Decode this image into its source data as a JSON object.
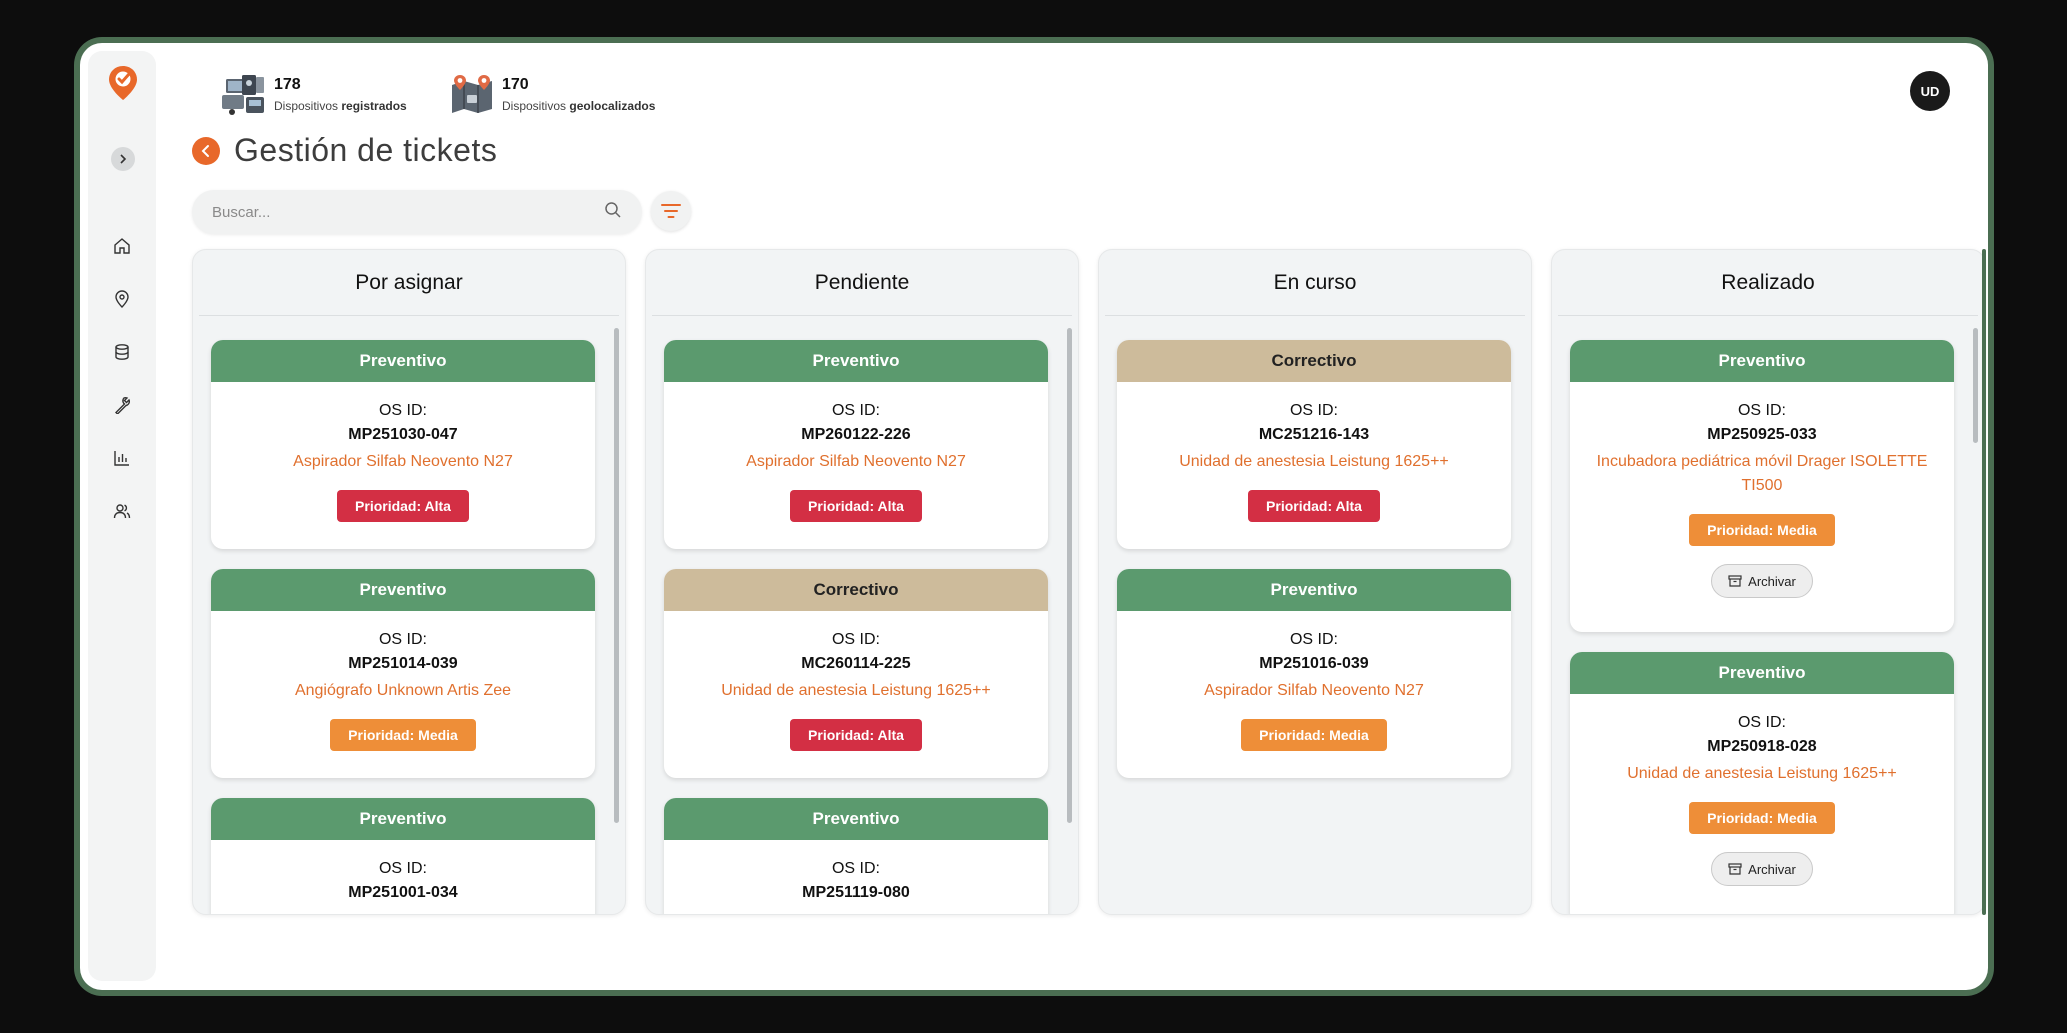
{
  "stats": [
    {
      "value": "178",
      "label_prefix": "Dispositivos",
      "label_bold": "registrados",
      "icon": "devices-registered-icon"
    },
    {
      "value": "170",
      "label_prefix": "Dispositivos",
      "label_bold": "geolocalizados",
      "icon": "devices-geolocated-icon"
    }
  ],
  "user": {
    "initials": "UD"
  },
  "page": {
    "title": "Gestión de tickets"
  },
  "search": {
    "placeholder": "Buscar..."
  },
  "sidebar": {
    "items": [
      "home-icon",
      "location-icon",
      "database-icon",
      "wrench-icon",
      "chart-icon",
      "users-icon"
    ]
  },
  "colors": {
    "accent": "#e8682a",
    "preventivo": "#5b9a6e",
    "correctivo": "#cdbb9b",
    "alta": "#d32f44",
    "media": "#ee8e38",
    "frame": "#4b6e52"
  },
  "columns": [
    {
      "title": "Por asignar",
      "cards": [
        {
          "type": "Preventivo",
          "os_label": "OS ID:",
          "os_id": "MP251030-047",
          "device": "Aspirador Silfab Neovento N27",
          "priority": "Prioridad: Alta"
        },
        {
          "type": "Preventivo",
          "os_label": "OS ID:",
          "os_id": "MP251014-039",
          "device": "Angiógrafo Unknown Artis Zee",
          "priority": "Prioridad: Media"
        },
        {
          "type": "Preventivo",
          "os_label": "OS ID:",
          "os_id": "MP251001-034",
          "device": "",
          "priority": ""
        }
      ]
    },
    {
      "title": "Pendiente",
      "cards": [
        {
          "type": "Preventivo",
          "os_label": "OS ID:",
          "os_id": "MP260122-226",
          "device": "Aspirador Silfab Neovento N27",
          "priority": "Prioridad: Alta"
        },
        {
          "type": "Correctivo",
          "os_label": "OS ID:",
          "os_id": "MC260114-225",
          "device": "Unidad de anestesia Leistung 1625++",
          "priority": "Prioridad: Alta"
        },
        {
          "type": "Preventivo",
          "os_label": "OS ID:",
          "os_id": "MP251119-080",
          "device": "",
          "priority": ""
        }
      ]
    },
    {
      "title": "En curso",
      "cards": [
        {
          "type": "Correctivo",
          "os_label": "OS ID:",
          "os_id": "MC251216-143",
          "device": "Unidad de anestesia Leistung 1625++",
          "priority": "Prioridad: Alta"
        },
        {
          "type": "Preventivo",
          "os_label": "OS ID:",
          "os_id": "MP251016-039",
          "device": "Aspirador Silfab Neovento N27",
          "priority": "Prioridad: Media"
        }
      ]
    },
    {
      "title": "Realizado",
      "cards": [
        {
          "type": "Preventivo",
          "os_label": "OS ID:",
          "os_id": "MP250925-033",
          "device": "Incubadora pediátrica móvil Drager ISOLETTE TI500",
          "priority": "Prioridad: Media",
          "archive": "Archivar"
        },
        {
          "type": "Preventivo",
          "os_label": "OS ID:",
          "os_id": "MP250918-028",
          "device": "Unidad de anestesia Leistung 1625++",
          "priority": "Prioridad: Media",
          "archive": "Archivar"
        }
      ]
    }
  ]
}
